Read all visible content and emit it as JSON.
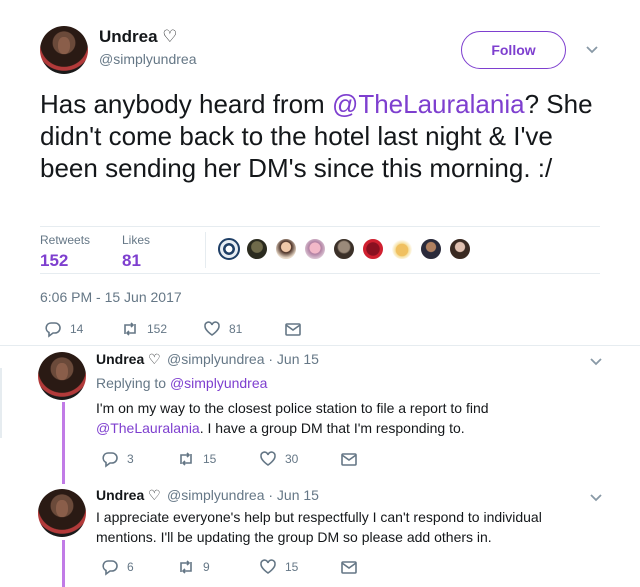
{
  "main_tweet": {
    "author_name": "Undrea ♡",
    "author_handle": "@simplyundrea",
    "follow_label": "Follow",
    "text_before": "Has anybody heard from ",
    "mention": "@TheLauralania",
    "text_after": "? She didn't come back to the hotel last night & I've been sending her DM's since this morning. :/",
    "retweets_label": "Retweets",
    "retweets_count": "152",
    "likes_label": "Likes",
    "likes_count": "81",
    "timestamp": "6:06 PM - 15 Jun 2017",
    "actions": {
      "reply": "14",
      "retweet": "152",
      "like": "81"
    }
  },
  "replies": [
    {
      "author_name": "Undrea ♡",
      "meta": "@simplyundrea · Jun 15",
      "replying_prefix": "Replying to ",
      "replying_to": "@simplyundrea",
      "text_before": "I'm on my way to the closest police station to file a report to find ",
      "mention": "@TheLauralania",
      "text_after": ". I have a group DM that I'm responding to.",
      "actions": {
        "reply": "3",
        "retweet": "15",
        "like": "30"
      }
    },
    {
      "author_name": "Undrea ♡",
      "meta": "@simplyundrea · Jun 15",
      "text": "I appreciate everyone's help but respectfully I can't respond to individual mentions. I'll be updating the group DM so please add others in.",
      "actions": {
        "reply": "6",
        "retweet": "9",
        "like": "15"
      }
    }
  ],
  "colors": {
    "accent": "#7e3fcf",
    "muted": "#657786",
    "thread": "#c17be6"
  },
  "icons": [
    "reply-icon",
    "retweet-icon",
    "like-icon",
    "message-icon",
    "chevron-down-icon"
  ]
}
